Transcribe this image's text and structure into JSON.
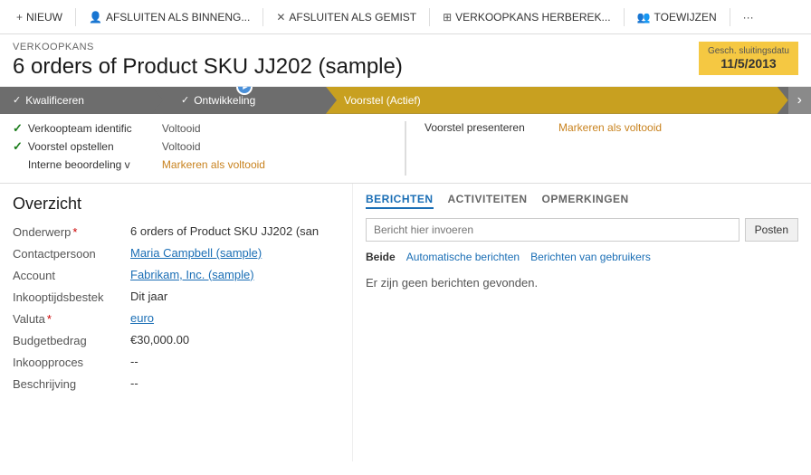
{
  "toolbar": {
    "buttons": [
      {
        "id": "nieuw",
        "icon": "+",
        "label": "NIEUW"
      },
      {
        "id": "afsluiten-binneng",
        "icon": "👤",
        "label": "AFSLUITEN ALS BINNENG..."
      },
      {
        "id": "afsluiten-gemist",
        "icon": "✕",
        "label": "AFSLUITEN ALS GEMIST"
      },
      {
        "id": "herberekenen",
        "icon": "⊞",
        "label": "VERKOOPKANS HERBEREK..."
      },
      {
        "id": "toewijzen",
        "icon": "👥",
        "label": "TOEWIJZEN"
      },
      {
        "id": "more",
        "icon": "···",
        "label": ""
      }
    ]
  },
  "header": {
    "subtitle": "VERKOOPKANS",
    "title": "6 orders of Product SKU JJ202 (sample)",
    "closing_date_label": "Gesch. sluitingsdatu",
    "closing_date_value": "11/5/2013"
  },
  "pipeline": {
    "stages": [
      {
        "id": "kwalificeren",
        "label": "Kwalificeren",
        "state": "completed",
        "check": true
      },
      {
        "id": "ontwikkeling",
        "label": "Ontwikkeling",
        "state": "completed",
        "check": true
      },
      {
        "id": "voorstel",
        "label": "Voorstel (Actief)",
        "state": "active",
        "check": false
      }
    ]
  },
  "steps": {
    "left_column": [
      {
        "id": "verkoopteam",
        "label": "Verkoopteam identific",
        "value": "Voltooid",
        "done": true,
        "action": false
      },
      {
        "id": "voorstel-opstellen",
        "label": "Voorstel opstellen",
        "value": "Voltooid",
        "done": true,
        "action": false
      },
      {
        "id": "interne-beoordeling",
        "label": "Interne beoordeling v",
        "value": "Markeren als voltooid",
        "done": false,
        "action": true
      }
    ],
    "right_column": [
      {
        "id": "voorstel-presenteren",
        "label": "Voorstel presenteren",
        "value": "Markeren als voltooid",
        "done": false,
        "action": true
      }
    ]
  },
  "overview": {
    "title": "Overzicht",
    "fields": [
      {
        "id": "onderwerp",
        "label": "Onderwerp",
        "required": true,
        "value": "6 orders of Product SKU JJ202 (san",
        "type": "text"
      },
      {
        "id": "contactpersoon",
        "label": "Contactpersoon",
        "required": false,
        "value": "Maria Campbell (sample)",
        "type": "link"
      },
      {
        "id": "account",
        "label": "Account",
        "required": false,
        "value": "Fabrikam, Inc. (sample)",
        "type": "link"
      },
      {
        "id": "inkooptijdsbestek",
        "label": "Inkooptijdsbestek",
        "required": false,
        "value": "Dit jaar",
        "type": "text"
      },
      {
        "id": "valuta",
        "label": "Valuta",
        "required": true,
        "value": "euro",
        "type": "link"
      },
      {
        "id": "budgetbedrag",
        "label": "Budgetbedrag",
        "required": false,
        "value": "€30,000.00",
        "type": "text"
      },
      {
        "id": "inkoopproces",
        "label": "Inkoopproces",
        "required": false,
        "value": "--",
        "type": "text"
      },
      {
        "id": "beschrijving",
        "label": "Beschrijving",
        "required": false,
        "value": "--",
        "type": "text"
      }
    ]
  },
  "messages": {
    "tabs": [
      {
        "id": "berichten",
        "label": "BERICHTEN",
        "active": true
      },
      {
        "id": "activiteiten",
        "label": "ACTIVITEITEN",
        "active": false
      },
      {
        "id": "opmerkingen",
        "label": "OPMERKINGEN",
        "active": false
      }
    ],
    "input_placeholder": "Bericht hier invoeren",
    "post_label": "Posten",
    "filters": [
      {
        "id": "beide",
        "label": "Beide",
        "active": true
      },
      {
        "id": "automatische",
        "label": "Automatische berichten",
        "active": false
      },
      {
        "id": "gebruikers",
        "label": "Berichten van gebruikers",
        "active": false
      }
    ],
    "empty_message": "Er zijn geen berichten gevonden."
  }
}
